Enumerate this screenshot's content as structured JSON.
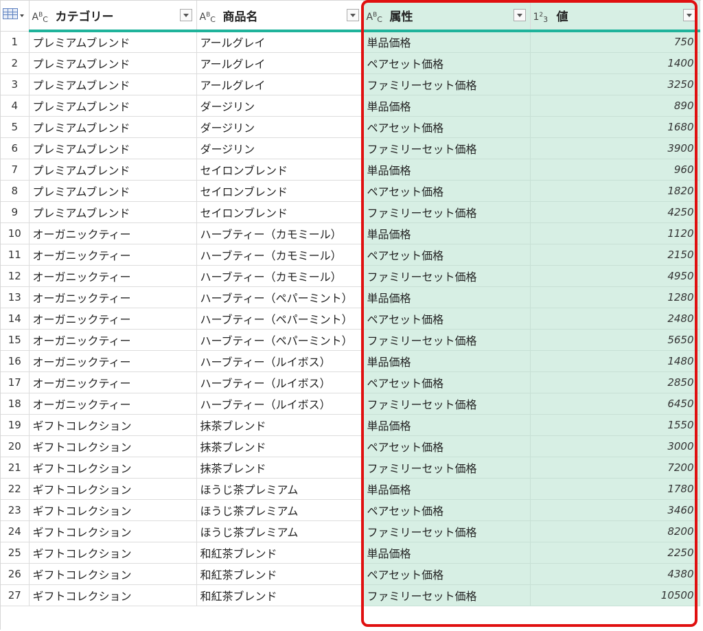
{
  "columns": {
    "category": {
      "type_icon": "ABC",
      "label": "カテゴリー"
    },
    "product": {
      "type_icon": "ABC",
      "label": "商品名"
    },
    "attribute": {
      "type_icon": "ABC",
      "label": "属性"
    },
    "value": {
      "type_icon": "123",
      "label": "値"
    }
  },
  "highlight_color": "#e01010",
  "selected_column_color": "#d7efe4",
  "header_accent_color": "#1fb39b",
  "rows": [
    {
      "idx": "1",
      "category": "プレミアムブレンド",
      "product": "アールグレイ",
      "attribute": "単品価格",
      "value": "750"
    },
    {
      "idx": "2",
      "category": "プレミアムブレンド",
      "product": "アールグレイ",
      "attribute": "ペアセット価格",
      "value": "1400"
    },
    {
      "idx": "3",
      "category": "プレミアムブレンド",
      "product": "アールグレイ",
      "attribute": "ファミリーセット価格",
      "value": "3250"
    },
    {
      "idx": "4",
      "category": "プレミアムブレンド",
      "product": "ダージリン",
      "attribute": "単品価格",
      "value": "890"
    },
    {
      "idx": "5",
      "category": "プレミアムブレンド",
      "product": "ダージリン",
      "attribute": "ペアセット価格",
      "value": "1680"
    },
    {
      "idx": "6",
      "category": "プレミアムブレンド",
      "product": "ダージリン",
      "attribute": "ファミリーセット価格",
      "value": "3900"
    },
    {
      "idx": "7",
      "category": "プレミアムブレンド",
      "product": "セイロンブレンド",
      "attribute": "単品価格",
      "value": "960"
    },
    {
      "idx": "8",
      "category": "プレミアムブレンド",
      "product": "セイロンブレンド",
      "attribute": "ペアセット価格",
      "value": "1820"
    },
    {
      "idx": "9",
      "category": "プレミアムブレンド",
      "product": "セイロンブレンド",
      "attribute": "ファミリーセット価格",
      "value": "4250"
    },
    {
      "idx": "10",
      "category": "オーガニックティー",
      "product": "ハーブティー（カモミール）",
      "attribute": "単品価格",
      "value": "1120"
    },
    {
      "idx": "11",
      "category": "オーガニックティー",
      "product": "ハーブティー（カモミール）",
      "attribute": "ペアセット価格",
      "value": "2150"
    },
    {
      "idx": "12",
      "category": "オーガニックティー",
      "product": "ハーブティー（カモミール）",
      "attribute": "ファミリーセット価格",
      "value": "4950"
    },
    {
      "idx": "13",
      "category": "オーガニックティー",
      "product": "ハーブティー（ペパーミント）",
      "attribute": "単品価格",
      "value": "1280"
    },
    {
      "idx": "14",
      "category": "オーガニックティー",
      "product": "ハーブティー（ペパーミント）",
      "attribute": "ペアセット価格",
      "value": "2480"
    },
    {
      "idx": "15",
      "category": "オーガニックティー",
      "product": "ハーブティー（ペパーミント）",
      "attribute": "ファミリーセット価格",
      "value": "5650"
    },
    {
      "idx": "16",
      "category": "オーガニックティー",
      "product": "ハーブティー（ルイボス）",
      "attribute": "単品価格",
      "value": "1480"
    },
    {
      "idx": "17",
      "category": "オーガニックティー",
      "product": "ハーブティー（ルイボス）",
      "attribute": "ペアセット価格",
      "value": "2850"
    },
    {
      "idx": "18",
      "category": "オーガニックティー",
      "product": "ハーブティー（ルイボス）",
      "attribute": "ファミリーセット価格",
      "value": "6450"
    },
    {
      "idx": "19",
      "category": "ギフトコレクション",
      "product": "抹茶ブレンド",
      "attribute": "単品価格",
      "value": "1550"
    },
    {
      "idx": "20",
      "category": "ギフトコレクション",
      "product": "抹茶ブレンド",
      "attribute": "ペアセット価格",
      "value": "3000"
    },
    {
      "idx": "21",
      "category": "ギフトコレクション",
      "product": "抹茶ブレンド",
      "attribute": "ファミリーセット価格",
      "value": "7200"
    },
    {
      "idx": "22",
      "category": "ギフトコレクション",
      "product": "ほうじ茶プレミアム",
      "attribute": "単品価格",
      "value": "1780"
    },
    {
      "idx": "23",
      "category": "ギフトコレクション",
      "product": "ほうじ茶プレミアム",
      "attribute": "ペアセット価格",
      "value": "3460"
    },
    {
      "idx": "24",
      "category": "ギフトコレクション",
      "product": "ほうじ茶プレミアム",
      "attribute": "ファミリーセット価格",
      "value": "8200"
    },
    {
      "idx": "25",
      "category": "ギフトコレクション",
      "product": "和紅茶ブレンド",
      "attribute": "単品価格",
      "value": "2250"
    },
    {
      "idx": "26",
      "category": "ギフトコレクション",
      "product": "和紅茶ブレンド",
      "attribute": "ペアセット価格",
      "value": "4380"
    },
    {
      "idx": "27",
      "category": "ギフトコレクション",
      "product": "和紅茶ブレンド",
      "attribute": "ファミリーセット価格",
      "value": "10500"
    }
  ]
}
